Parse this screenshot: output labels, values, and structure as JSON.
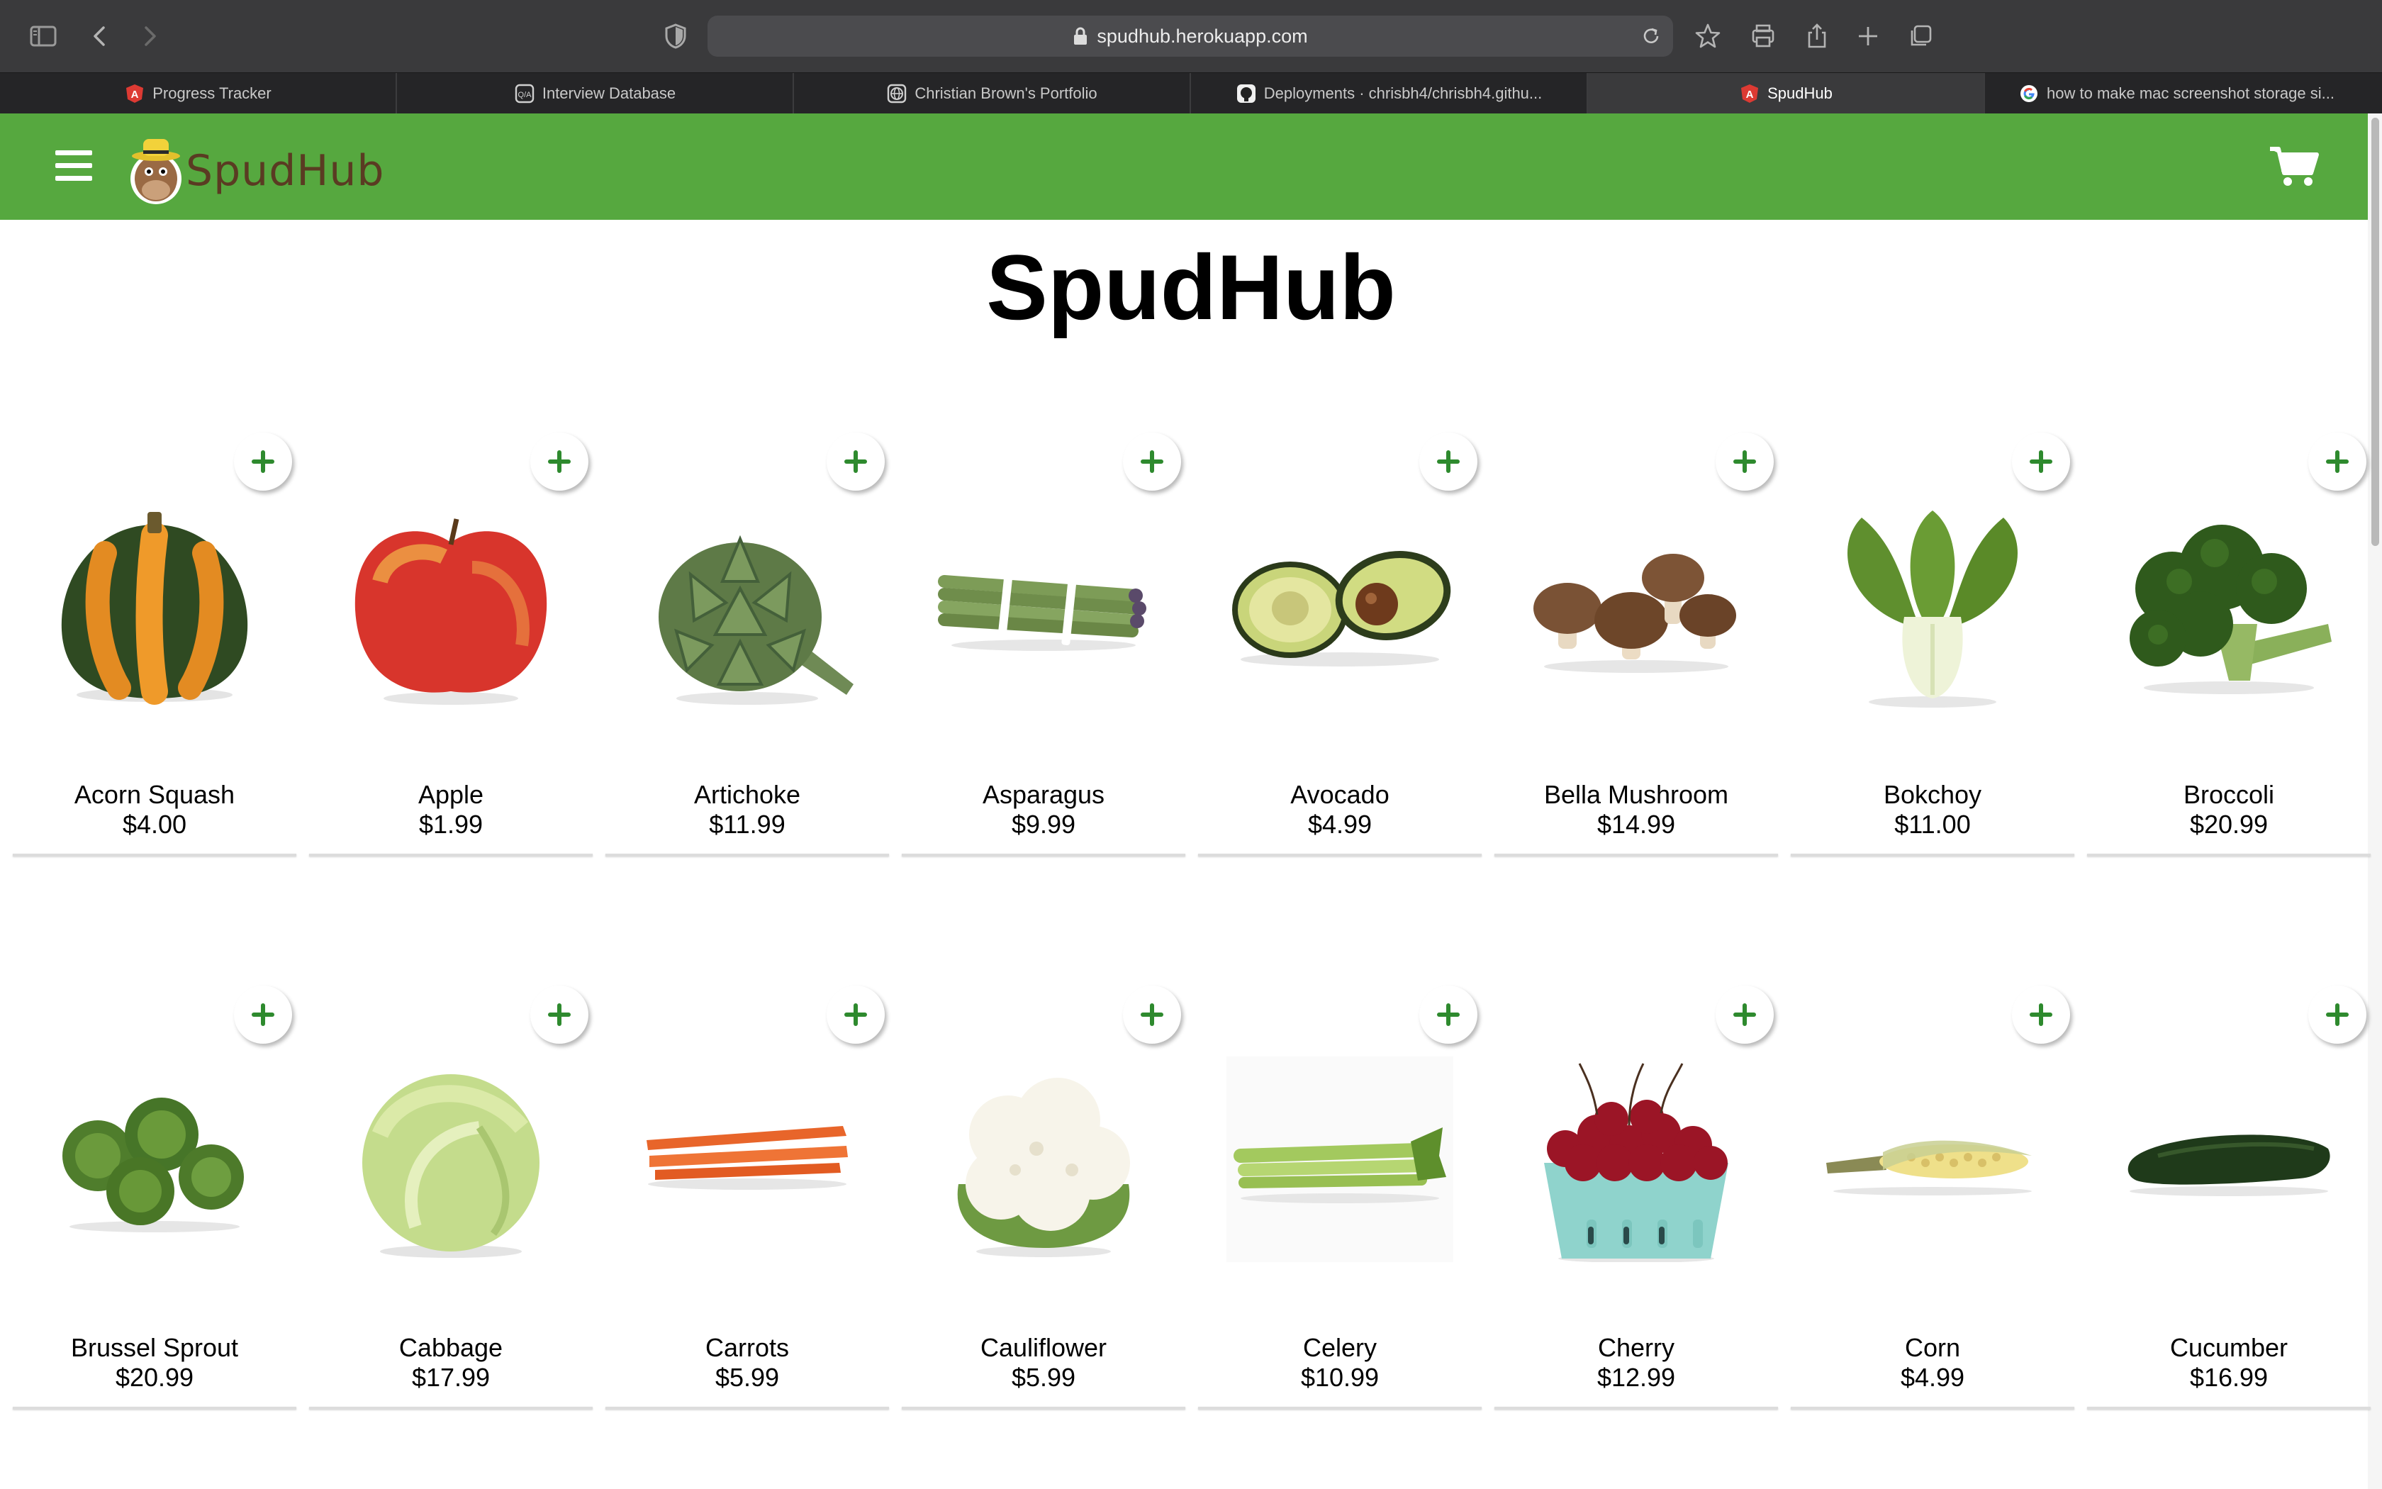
{
  "browser": {
    "url": "spudhub.herokuapp.com",
    "tabs": [
      {
        "label": "Progress Tracker",
        "icon": "angular-icon",
        "active": false
      },
      {
        "label": "Interview Database",
        "icon": "database-icon",
        "active": false
      },
      {
        "label": "Christian Brown's Portfolio",
        "icon": "globe-icon",
        "active": false
      },
      {
        "label": "Deployments · chrisbh4/chrisbh4.githu...",
        "icon": "github-icon",
        "active": false
      },
      {
        "label": "SpudHub",
        "icon": "angular-icon",
        "active": true
      },
      {
        "label": "how to make mac screenshot storage si...",
        "icon": "google-icon",
        "active": false
      }
    ]
  },
  "header": {
    "logo_text": "SpudHub",
    "background": "#56a83f"
  },
  "page": {
    "title": "SpudHub"
  },
  "products": [
    {
      "name": "Acorn Squash",
      "price": "$4.00",
      "icon": "acorn-squash-image"
    },
    {
      "name": "Apple",
      "price": "$1.99",
      "icon": "apple-image"
    },
    {
      "name": "Artichoke",
      "price": "$11.99",
      "icon": "artichoke-image"
    },
    {
      "name": "Asparagus",
      "price": "$9.99",
      "icon": "asparagus-image"
    },
    {
      "name": "Avocado",
      "price": "$4.99",
      "icon": "avocado-image"
    },
    {
      "name": "Bella Mushroom",
      "price": "$14.99",
      "icon": "mushroom-image"
    },
    {
      "name": "Bokchoy",
      "price": "$11.00",
      "icon": "bokchoy-image"
    },
    {
      "name": "Broccoli",
      "price": "$20.99",
      "icon": "broccoli-image"
    },
    {
      "name": "Brussel Sprout",
      "price": "$20.99",
      "icon": "brussel-sprout-image"
    },
    {
      "name": "Cabbage",
      "price": "$17.99",
      "icon": "cabbage-image"
    },
    {
      "name": "Carrots",
      "price": "$5.99",
      "icon": "carrots-image"
    },
    {
      "name": "Cauliflower",
      "price": "$5.99",
      "icon": "cauliflower-image"
    },
    {
      "name": "Celery",
      "price": "$10.99",
      "icon": "celery-image"
    },
    {
      "name": "Cherry",
      "price": "$12.99",
      "icon": "cherry-image"
    },
    {
      "name": "Corn",
      "price": "$4.99",
      "icon": "corn-image"
    },
    {
      "name": "Cucumber",
      "price": "$16.99",
      "icon": "cucumber-image"
    }
  ],
  "colors": {
    "accent": "#56a83f",
    "plus": "#2e8a2e"
  }
}
